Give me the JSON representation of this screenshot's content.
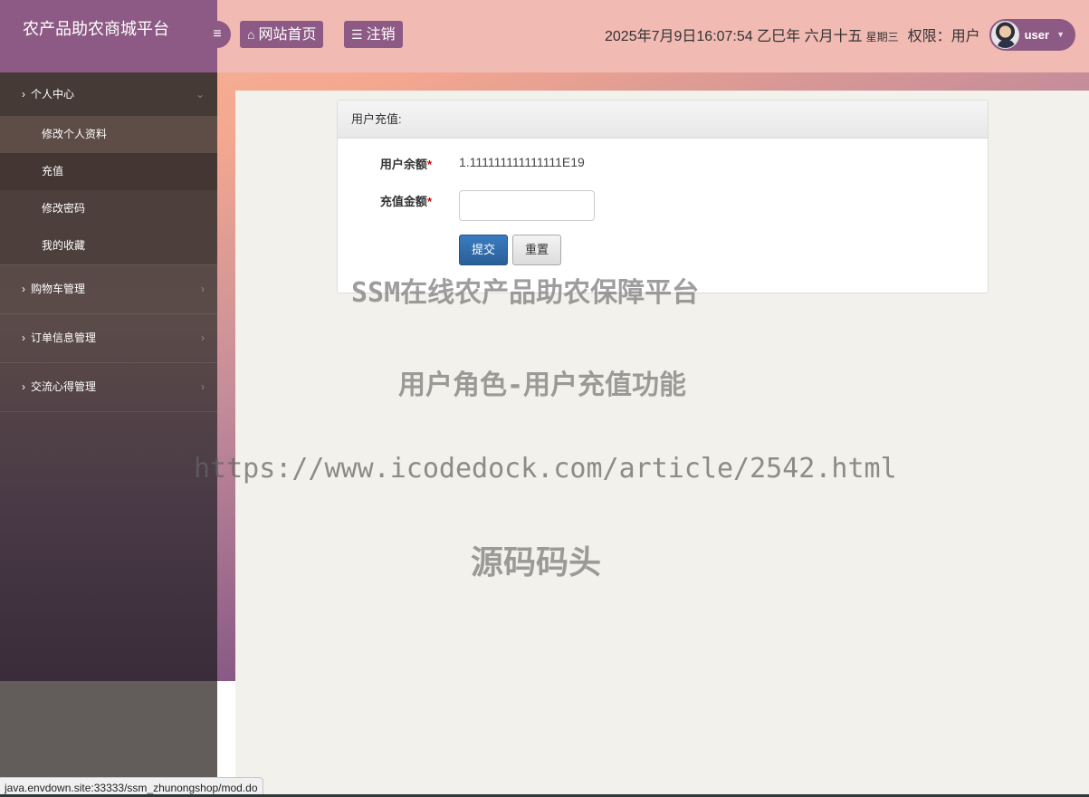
{
  "header": {
    "brand": "农产品助农商城平台",
    "toggle_icon": "bars-icon",
    "nav": [
      {
        "label": "网站首页",
        "icon": "home-icon"
      },
      {
        "label": "注销",
        "icon": "list-icon"
      }
    ],
    "datetime": "2025年7月9日16:07:54 乙巳年 六月十五",
    "weekday": "星期三",
    "permission": "权限：用户",
    "username": "user"
  },
  "sidebar": {
    "groups": [
      {
        "label": "个人中心",
        "items": [
          "修改个人资料",
          "充值",
          "修改密码",
          "我的收藏"
        ]
      },
      {
        "label": "购物车管理"
      },
      {
        "label": "订单信息管理"
      },
      {
        "label": "交流心得管理"
      }
    ]
  },
  "panel": {
    "title": "用户充值:",
    "balance_label": "用户余额",
    "balance_value": "1.111111111111111E19",
    "amount_label": "充值金额",
    "amount_value": "",
    "required_mark": "*",
    "submit_label": "提交",
    "reset_label": "重置"
  },
  "watermark": {
    "line1": "SSM在线农产品助农保障平台",
    "line2": "用户角色-用户充值功能",
    "line3": "https://www.icodedock.com/article/2542.html",
    "line4": "源码码头"
  },
  "status_bar": {
    "url": "java.envdown.site:33333/ssm_zhunongshop/mod.do"
  },
  "colors": {
    "header_bg": "#f1bab3",
    "brand_bg": "#8c5a84",
    "sidebar_bg": "#564742",
    "submit_bg": "#2a5f98"
  }
}
